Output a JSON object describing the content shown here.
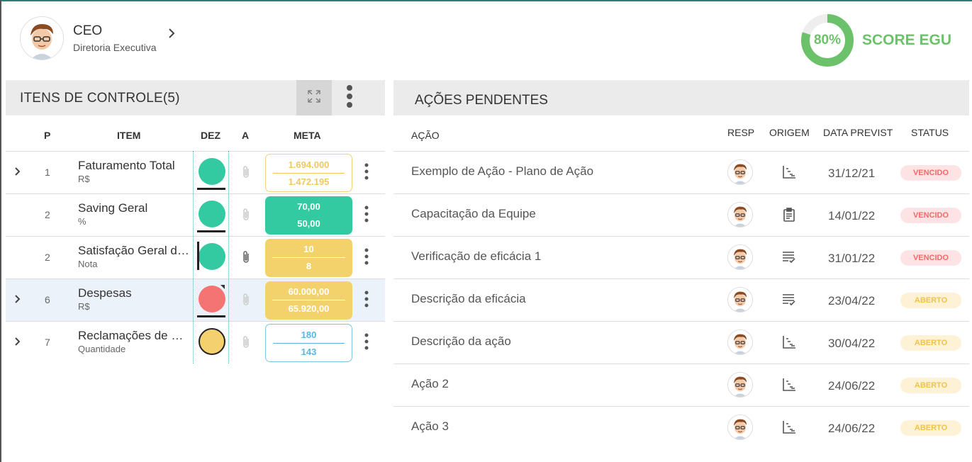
{
  "profile": {
    "title": "CEO",
    "subtitle": "Diretoria Executiva"
  },
  "score": {
    "percent_label": "80%",
    "percent": 80,
    "label": "SCORE EGU",
    "color": "#6cc26a"
  },
  "left_panel": {
    "title": "ITENS DE CONTROLE(5)",
    "columns": {
      "p": "P",
      "item": "ITEM",
      "dez": "DEZ",
      "a": "A",
      "meta": "META"
    },
    "rows": [
      {
        "p": "1",
        "name": "Faturamento Total",
        "unit": "R$",
        "expandable": true,
        "status_color": "#33c9a1",
        "meta_top": "1.694.000",
        "meta_bottom": "1.472.195",
        "meta_style": "outline-yellow",
        "attachment": false
      },
      {
        "p": "2",
        "name": "Saving Geral",
        "unit": "%",
        "expandable": false,
        "status_color": "#33c9a1",
        "meta_top": "70,00",
        "meta_bottom": "50,00",
        "meta_style": "fill-green",
        "attachment": false
      },
      {
        "p": "2",
        "name": "Satisfação Geral de Clientes",
        "unit": "Nota",
        "expandable": false,
        "status_color": "#33c9a1",
        "meta_top": "10",
        "meta_bottom": "8",
        "meta_style": "fill-yellow",
        "attachment": true
      },
      {
        "p": "6",
        "name": "Despesas",
        "unit": "R$",
        "expandable": true,
        "status_color": "#f47474",
        "meta_top": "60.000,00",
        "meta_bottom": "65.920,00",
        "meta_style": "fill-yellow",
        "attachment": false
      },
      {
        "p": "7",
        "name": "Reclamações de Clientes",
        "unit": "Quantidade",
        "expandable": true,
        "status_color": "#f5d06e",
        "meta_top": "180",
        "meta_bottom": "143",
        "meta_style": "outline-blue",
        "attachment": false
      }
    ]
  },
  "right_panel": {
    "title": "AÇÕES PENDENTES",
    "columns": {
      "action": "AÇÃO",
      "resp": "RESP",
      "origin": "ORIGEM",
      "date": "DATA PREVIST",
      "status": "STATUS"
    },
    "rows": [
      {
        "action": "Exemplo de Ação - Plano de Ação",
        "origin_icon": "chart-steps-icon",
        "date": "31/12/21",
        "status": "VENCIDO",
        "status_kind": "vencido"
      },
      {
        "action": "Capacitação da Equipe",
        "origin_icon": "clipboard-icon",
        "date": "14/01/22",
        "status": "VENCIDO",
        "status_kind": "vencido"
      },
      {
        "action": "Verificação de eficácia 1",
        "origin_icon": "checklist-icon",
        "date": "31/01/22",
        "status": "VENCIDO",
        "status_kind": "vencido"
      },
      {
        "action": "Descrição da eficácia",
        "origin_icon": "checklist-icon",
        "date": "23/04/22",
        "status": "ABERTO",
        "status_kind": "aberto"
      },
      {
        "action": "Descrição da ação",
        "origin_icon": "chart-steps-icon",
        "date": "30/04/22",
        "status": "ABERTO",
        "status_kind": "aberto"
      },
      {
        "action": "Ação 2",
        "origin_icon": "chart-steps-icon",
        "date": "24/06/22",
        "status": "ABERTO",
        "status_kind": "aberto"
      },
      {
        "action": "Ação 3",
        "origin_icon": "chart-steps-icon",
        "date": "24/06/22",
        "status": "ABERTO",
        "status_kind": "aberto"
      }
    ]
  }
}
